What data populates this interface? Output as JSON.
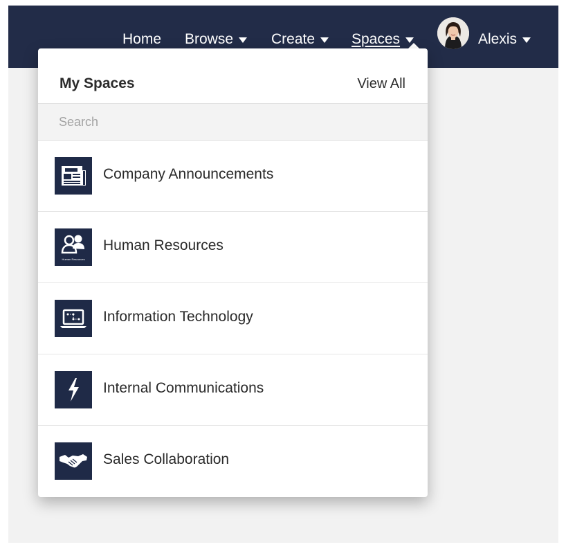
{
  "nav": {
    "home": "Home",
    "browse": "Browse",
    "create": "Create",
    "spaces": "Spaces",
    "user_name": "Alexis"
  },
  "dropdown": {
    "title": "My Spaces",
    "view_all": "View All",
    "search_placeholder": "Search",
    "search_value": "",
    "items": [
      {
        "label": "Company Announcements",
        "icon": "newspaper-icon"
      },
      {
        "label": "Human Resources",
        "icon": "people-icon",
        "icon_caption": "Human Resources"
      },
      {
        "label": "Information Technology",
        "icon": "laptop-icon"
      },
      {
        "label": "Internal Communications",
        "icon": "lightning-bolt-icon"
      },
      {
        "label": "Sales Collaboration",
        "icon": "handshake-icon"
      }
    ]
  },
  "colors": {
    "topbar": "#222c48",
    "tile": "#1f2a47",
    "background": "#f2f2f2"
  }
}
